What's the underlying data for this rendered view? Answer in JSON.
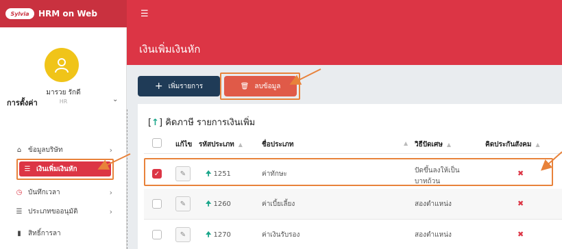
{
  "topbar": {
    "logo_text": "Sylvia",
    "app_name": "HRM on Web",
    "menu_icon": "hamburger-icon"
  },
  "user": {
    "name": "มารวย รักดี",
    "role": "HR"
  },
  "sidebar": {
    "section_title": "การตั้งค่า",
    "items": [
      {
        "label": "ข้อมูลบริษัท",
        "icon": "home-icon",
        "chevron": "›"
      },
      {
        "label": "เงินเพิ่มเงินหัก",
        "icon": "list-icon",
        "active": true
      },
      {
        "label": "บันทึกเวลา",
        "icon": "clock-icon",
        "chevron": "›"
      },
      {
        "label": "ประเภทขออนุมัติ",
        "icon": "list-icon",
        "chevron": "›"
      },
      {
        "label": "สิทธิ์การลา",
        "icon": "document-icon"
      }
    ]
  },
  "main": {
    "page_title": "เงินเพิ่มเงินหัก",
    "add_button": "เพิ่มรายการ",
    "add_icon": "+",
    "delete_button": "ลบข้อมูล",
    "card_title_icon": "↑",
    "card_title": "คิดภาษี รายการเงินเพิ่ม",
    "columns": [
      "แก้ไข",
      "รหัสประเภท",
      "ชื่อประเภท",
      "วิธีปัดเศษ",
      "คิดประกันสังคม"
    ],
    "rows": [
      {
        "checked": true,
        "code": "1251",
        "name": "ค่าทักษะ",
        "rounding": "ปัดขึ้นลงให้เป็น",
        "rounding2": "บาทถ้วน",
        "sso": "✖"
      },
      {
        "checked": false,
        "code": "1260",
        "name": "ค่าเบี้ยเลี้ยง",
        "rounding": "สองตำแหน่ง",
        "rounding2": "",
        "sso": "✖"
      },
      {
        "checked": false,
        "code": "1270",
        "name": "ค่าเงินรับรอง",
        "rounding": "สองตำแหน่ง",
        "rounding2": "",
        "sso": "✖"
      }
    ]
  },
  "colors": {
    "primary_red": "#dc3545",
    "navy": "#1f3b57",
    "teal": "#1aa68a",
    "highlight_orange": "#e8823a"
  }
}
